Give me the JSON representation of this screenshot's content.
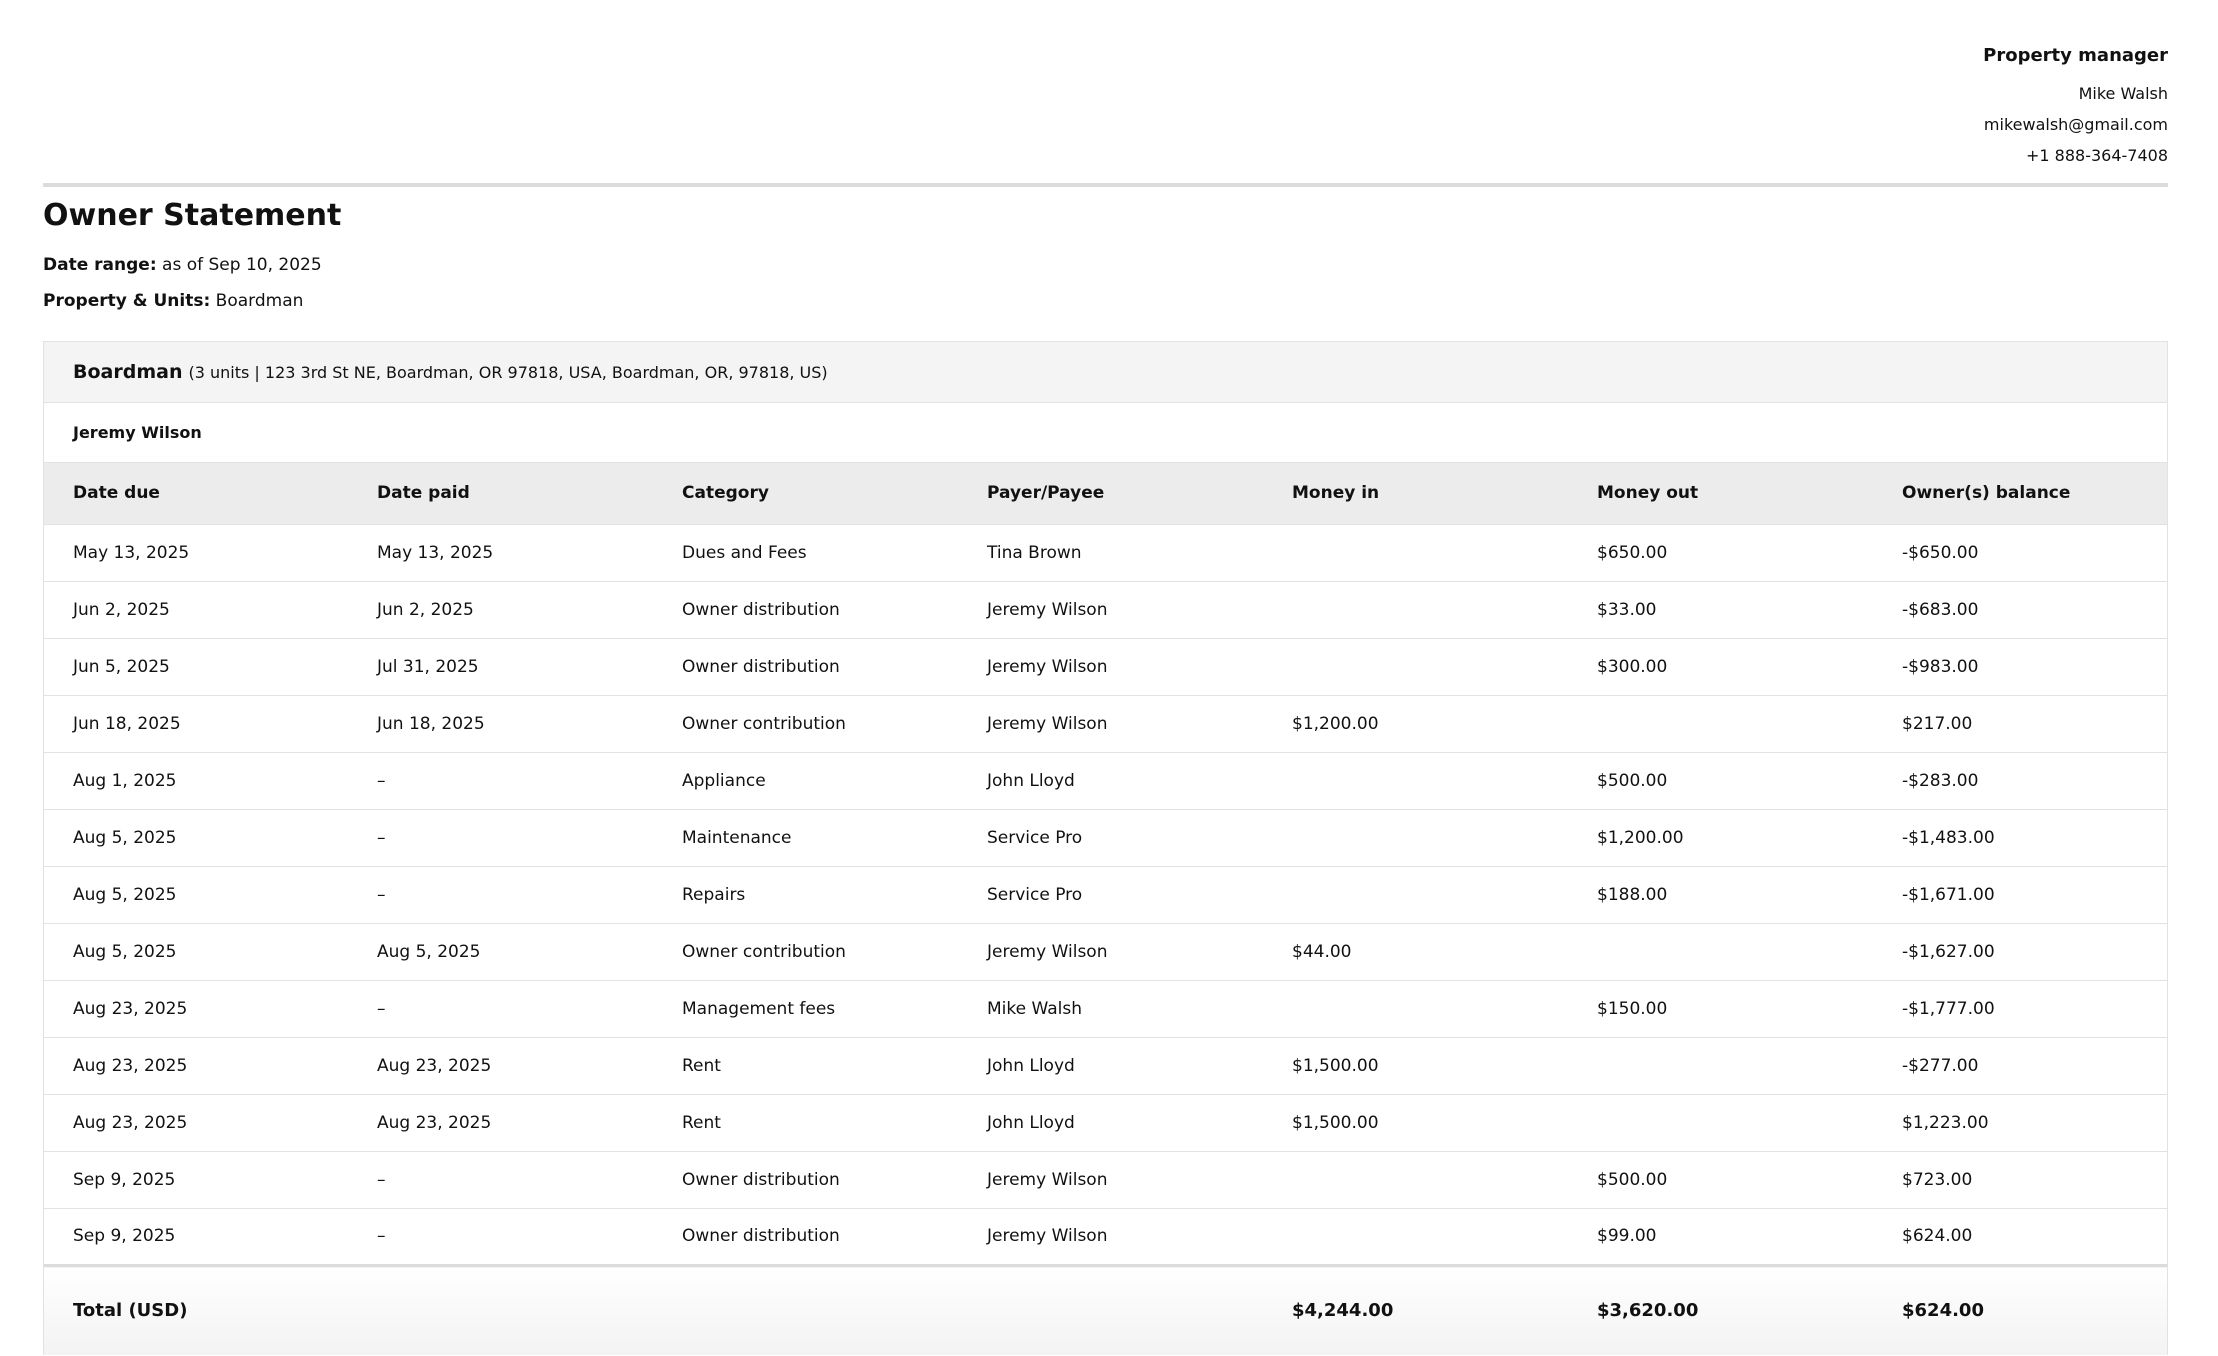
{
  "manager": {
    "title": "Property manager",
    "name": "Mike Walsh",
    "email": "mikewalsh@gmail.com",
    "phone": "+1 888-364-7408"
  },
  "statement": {
    "title": "Owner Statement",
    "date_range_label": "Date range:",
    "date_range_value": "as of Sep 10, 2025",
    "property_units_label": "Property & Units:",
    "property_units_value": "Boardman"
  },
  "property": {
    "name": "Boardman",
    "details": "(3 units | 123 3rd St NE, Boardman, OR 97818, USA, Boardman, OR, 97818, US)",
    "owner": "Jeremy Wilson"
  },
  "table": {
    "columns": [
      "Date due",
      "Date paid",
      "Category",
      "Payer/Payee",
      "Money in",
      "Money out",
      "Owner(s) balance"
    ],
    "rows": [
      [
        "May 13, 2025",
        "May 13, 2025",
        "Dues and Fees",
        "Tina Brown",
        "",
        "$650.00",
        "-$650.00"
      ],
      [
        "Jun 2, 2025",
        "Jun 2, 2025",
        "Owner distribution",
        "Jeremy Wilson",
        "",
        "$33.00",
        "-$683.00"
      ],
      [
        "Jun 5, 2025",
        "Jul 31, 2025",
        "Owner distribution",
        "Jeremy Wilson",
        "",
        "$300.00",
        "-$983.00"
      ],
      [
        "Jun 18, 2025",
        "Jun 18, 2025",
        "Owner contribution",
        "Jeremy Wilson",
        "$1,200.00",
        "",
        "$217.00"
      ],
      [
        "Aug 1, 2025",
        "–",
        "Appliance",
        "John Lloyd",
        "",
        "$500.00",
        "-$283.00"
      ],
      [
        "Aug 5, 2025",
        "–",
        "Maintenance",
        "Service Pro",
        "",
        "$1,200.00",
        "-$1,483.00"
      ],
      [
        "Aug 5, 2025",
        "–",
        "Repairs",
        "Service Pro",
        "",
        "$188.00",
        "-$1,671.00"
      ],
      [
        "Aug 5, 2025",
        "Aug 5, 2025",
        "Owner contribution",
        "Jeremy Wilson",
        "$44.00",
        "",
        "-$1,627.00"
      ],
      [
        "Aug 23, 2025",
        "–",
        "Management fees",
        "Mike Walsh",
        "",
        "$150.00",
        "-$1,777.00"
      ],
      [
        "Aug 23, 2025",
        "Aug 23, 2025",
        "Rent",
        "John Lloyd",
        "$1,500.00",
        "",
        "-$277.00"
      ],
      [
        "Aug 23, 2025",
        "Aug 23, 2025",
        "Rent",
        "John Lloyd",
        "$1,500.00",
        "",
        "$1,223.00"
      ],
      [
        "Sep 9, 2025",
        "–",
        "Owner distribution",
        "Jeremy Wilson",
        "",
        "$500.00",
        "$723.00"
      ],
      [
        "Sep 9, 2025",
        "–",
        "Owner distribution",
        "Jeremy Wilson",
        "",
        "$99.00",
        "$624.00"
      ]
    ],
    "total": {
      "label": "Total (USD)",
      "money_in": "$4,244.00",
      "money_out": "$3,620.00",
      "balance": "$624.00"
    }
  }
}
